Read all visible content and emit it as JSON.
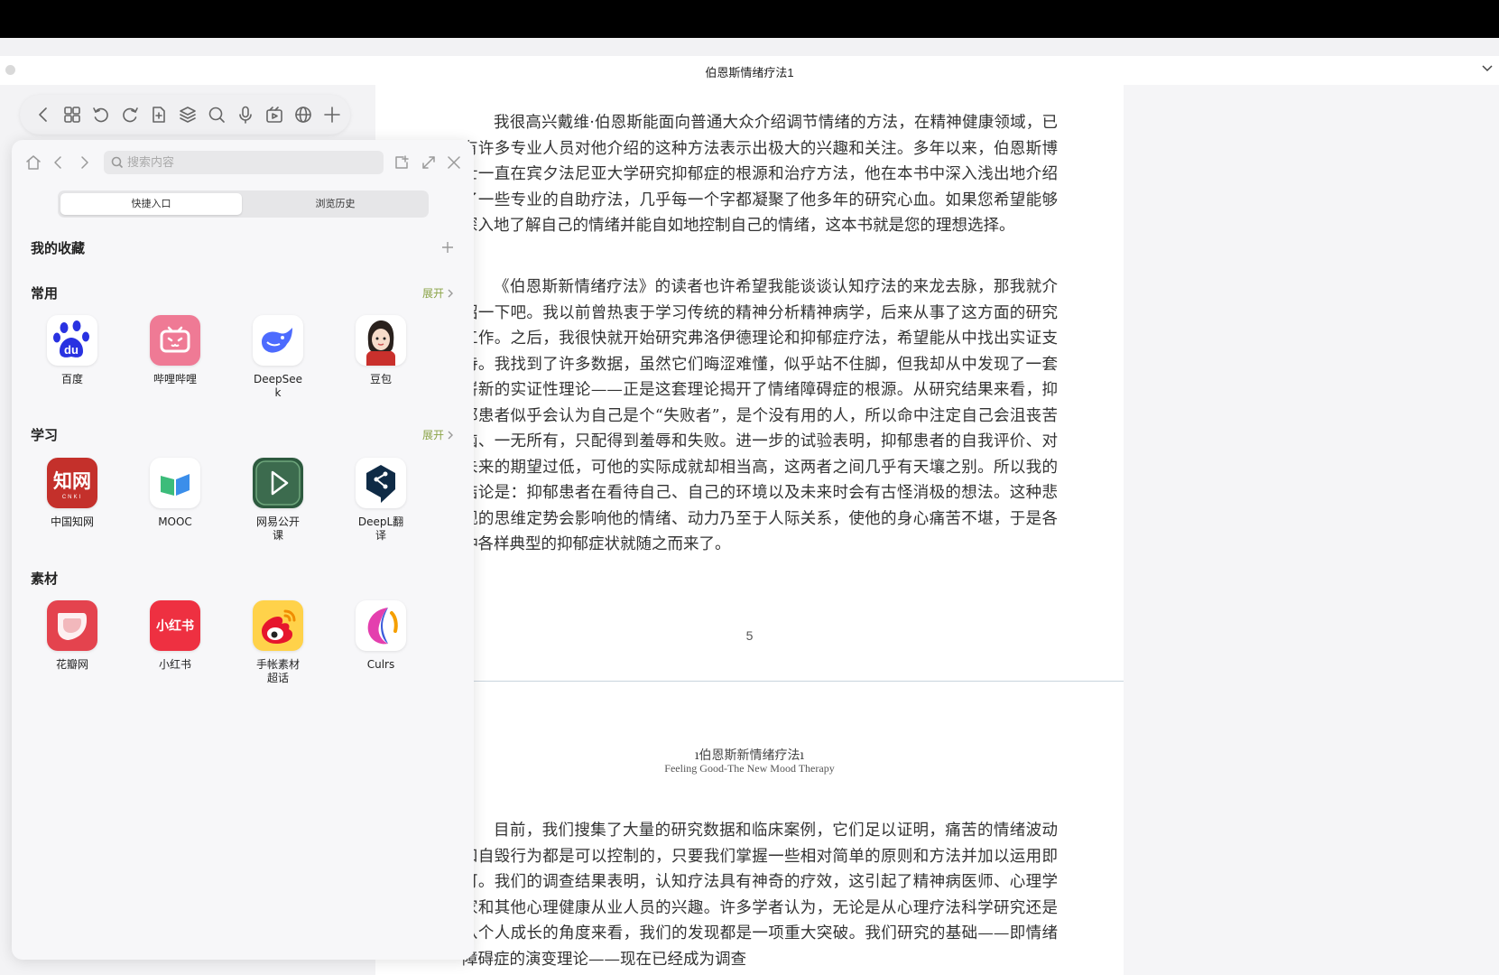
{
  "window": {
    "title": "伯恩斯情绪疗法1"
  },
  "panel": {
    "search_placeholder": "搜索内容",
    "tabs": [
      "快捷入口",
      "浏览历史"
    ],
    "favorites_title": "我的收藏",
    "sections": [
      {
        "title": "常用",
        "expand": "展开",
        "apps": [
          {
            "label": "百度",
            "icon": "baidu-icon"
          },
          {
            "label": "哔哩哔哩",
            "icon": "bilibili-icon"
          },
          {
            "label": "DeepSeek",
            "icon": "deepseek-icon"
          },
          {
            "label": "豆包",
            "icon": "doubao-icon"
          }
        ]
      },
      {
        "title": "学习",
        "expand": "展开",
        "apps": [
          {
            "label": "中国知网",
            "icon": "cnki-icon"
          },
          {
            "label": "MOOC",
            "icon": "mooc-icon"
          },
          {
            "label": "网易公开课",
            "icon": "netease-open-course-icon"
          },
          {
            "label": "DeepL翻译",
            "icon": "deepl-icon"
          }
        ]
      },
      {
        "title": "素材",
        "apps": [
          {
            "label": "花瓣网",
            "icon": "huaban-icon"
          },
          {
            "label": "小红书",
            "icon": "xiaohongshu-icon"
          },
          {
            "label": "手帐素材超话",
            "icon": "weibo-icon"
          },
          {
            "label": "Culrs",
            "icon": "culrs-icon"
          }
        ]
      }
    ]
  },
  "document": {
    "paragraphs": [
      "我很高兴戴维·伯恩斯能面向普通大众介绍调节情绪的方法，在精神健康领域，已有许多专业人员对他介绍的这种方法表示出极大的兴趣和关注。多年以来，伯恩斯博士一直在宾夕法尼亚大学研究抑郁症的根源和治疗方法，他在本书中深入浅出地介绍了一些专业的自助疗法，几乎每一个字都凝聚了他多年的研究心血。如果您希望能够深入地了解自己的情绪并能自如地控制自己的情绪，这本书就是您的理想选择。",
      "《伯恩斯新情绪疗法》的读者也许希望我能谈谈认知疗法的来龙去脉，那我就介绍一下吧。我以前曾热衷于学习传统的精神分析精神病学，后来从事了这方面的研究工作。之后，我很快就开始研究弗洛伊德理论和抑郁症疗法，希望能从中找出实证支持。我找到了许多数据，虽然它们晦涩难懂，似乎站不住脚，但我却从中发现了一套崭新的实证性理论——正是这套理论揭开了情绪障碍症的根源。从研究结果来看，抑郁患者似乎会认为自己是个“失败者”，是个没有用的人，所以命中注定自己会沮丧苦恼、一无所有，只配得到羞辱和失败。进一步的试验表明，抑郁患者的自我评价、对未来的期望过低，可他的实际成就却相当高，这两者之间几乎有天壤之别。所以我的结论是：抑郁患者在看待自己、自己的环境以及未来时会有古怪消极的想法。这种悲观的思维定势会影响他的情绪、动力乃至于人际关系，使他的身心痛苦不堪，于是各种各样典型的抑郁症状就随之而来了。"
    ],
    "page_number": "5",
    "running_head": "伯恩斯新情绪疗法",
    "running_head_en": "Feeling Good-The New Mood Therapy",
    "next_page_paragraph": "目前，我们搜集了大量的研究数据和临床案例，它们足以证明，痛苦的情绪波动和自毁行为都是可以控制的，只要我们掌握一些相对简单的原则和方法并加以运用即可。我们的调查结果表明，认知疗法具有神奇的疗效，这引起了精神病医师、心理学家和其他心理健康从业人员的兴趣。许多学者认为，无论是从心理疗法科学研究还是从个人成长的角度来看，我们的发现都是一项重大突破。我们研究的基础——即情绪障碍症的演变理论——现在已经成为调查"
  },
  "colors": {
    "accent_expand": "#8aa346",
    "page_bg": "#ffffff"
  }
}
